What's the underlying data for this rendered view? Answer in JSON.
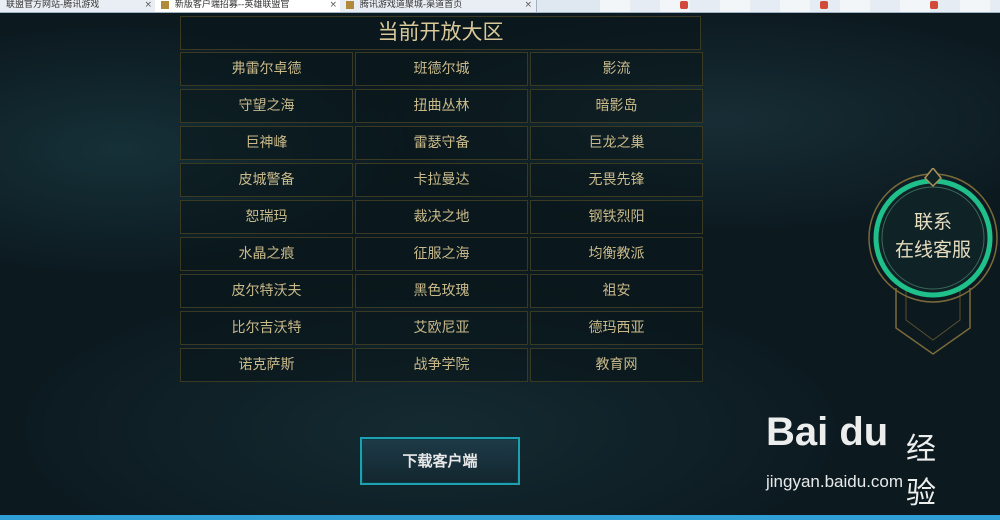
{
  "browser": {
    "tabs": [
      {
        "label": "联盟官方网站-腾讯游戏",
        "active": false
      },
      {
        "label": "新版客户端招募--英雄联盟官",
        "active": true
      },
      {
        "label": "腾讯游戏道聚城-渠道首页",
        "active": false
      }
    ],
    "close_glyph": "×"
  },
  "server_list": {
    "title": "当前开放大区",
    "servers": [
      "弗雷尔卓德",
      "班德尔城",
      "影流",
      "守望之海",
      "扭曲丛林",
      "暗影岛",
      "巨神峰",
      "雷瑟守备",
      "巨龙之巢",
      "皮城警备",
      "卡拉曼达",
      "无畏先锋",
      "恕瑞玛",
      "裁决之地",
      "钢铁烈阳",
      "水晶之痕",
      "征服之海",
      "均衡教派",
      "皮尔特沃夫",
      "黑色玫瑰",
      "祖安",
      "比尔吉沃特",
      "艾欧尼亚",
      "德玛西亚",
      "诺克萨斯",
      "战争学院",
      "教育网"
    ]
  },
  "download_button": {
    "label": "下载客户端"
  },
  "customer_service": {
    "line1": "联系",
    "line2": "在线客服"
  },
  "watermark": {
    "logo": "Bai du",
    "brand_cn": "经验",
    "url": "jingyan.baidu.com"
  },
  "colors": {
    "accent": "#1ea0b0",
    "gold": "#c8b98a",
    "badge_ring": "#1fc08a"
  }
}
